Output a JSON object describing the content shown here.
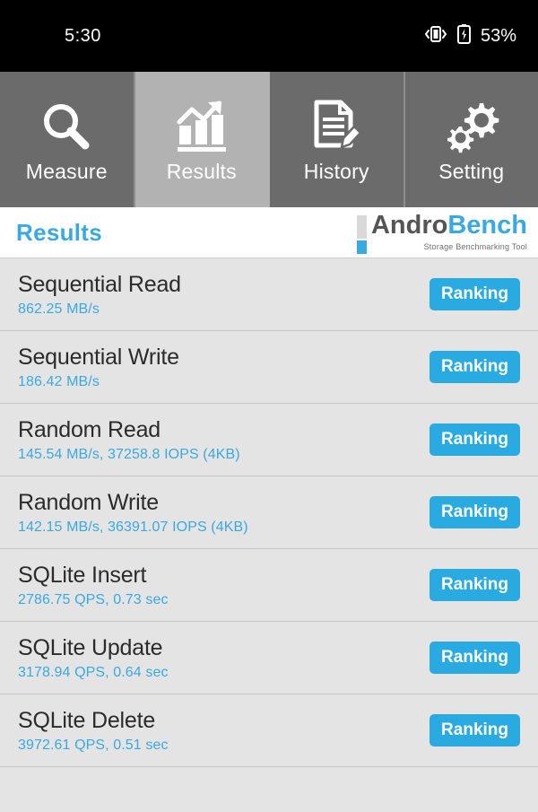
{
  "statusbar": {
    "time": "5:30",
    "battery_percent": "53%",
    "vibrate_icon": "vibrate-icon",
    "battery_icon": "battery-charging-icon"
  },
  "tabs": [
    {
      "label": "Measure",
      "icon": "magnifier-icon",
      "active": false
    },
    {
      "label": "Results",
      "icon": "bar-chart-icon",
      "active": true
    },
    {
      "label": "History",
      "icon": "document-pen-icon",
      "active": false
    },
    {
      "label": "Setting",
      "icon": "gears-icon",
      "active": false
    }
  ],
  "header": {
    "title": "Results",
    "logo_andro": "Andro",
    "logo_bench": "Bench",
    "logo_tagline": "Storage Benchmarking Tool"
  },
  "colors": {
    "accent_blue": "#29abe2",
    "value_blue": "#3aa9e0",
    "tab_inactive": "#6b6b6b",
    "tab_active": "#b2b2b2",
    "list_bg": "#e4e4e4"
  },
  "results": [
    {
      "name": "Sequential Read",
      "value": "862.25 MB/s",
      "button": "Ranking"
    },
    {
      "name": "Sequential Write",
      "value": "186.42 MB/s",
      "button": "Ranking"
    },
    {
      "name": "Random Read",
      "value": "145.54 MB/s, 37258.8 IOPS (4KB)",
      "button": "Ranking"
    },
    {
      "name": "Random Write",
      "value": "142.15 MB/s, 36391.07 IOPS (4KB)",
      "button": "Ranking"
    },
    {
      "name": "SQLite Insert",
      "value": "2786.75 QPS, 0.73 sec",
      "button": "Ranking"
    },
    {
      "name": "SQLite Update",
      "value": "3178.94 QPS, 0.64 sec",
      "button": "Ranking"
    },
    {
      "name": "SQLite Delete",
      "value": "3972.61 QPS, 0.51 sec",
      "button": "Ranking"
    }
  ]
}
